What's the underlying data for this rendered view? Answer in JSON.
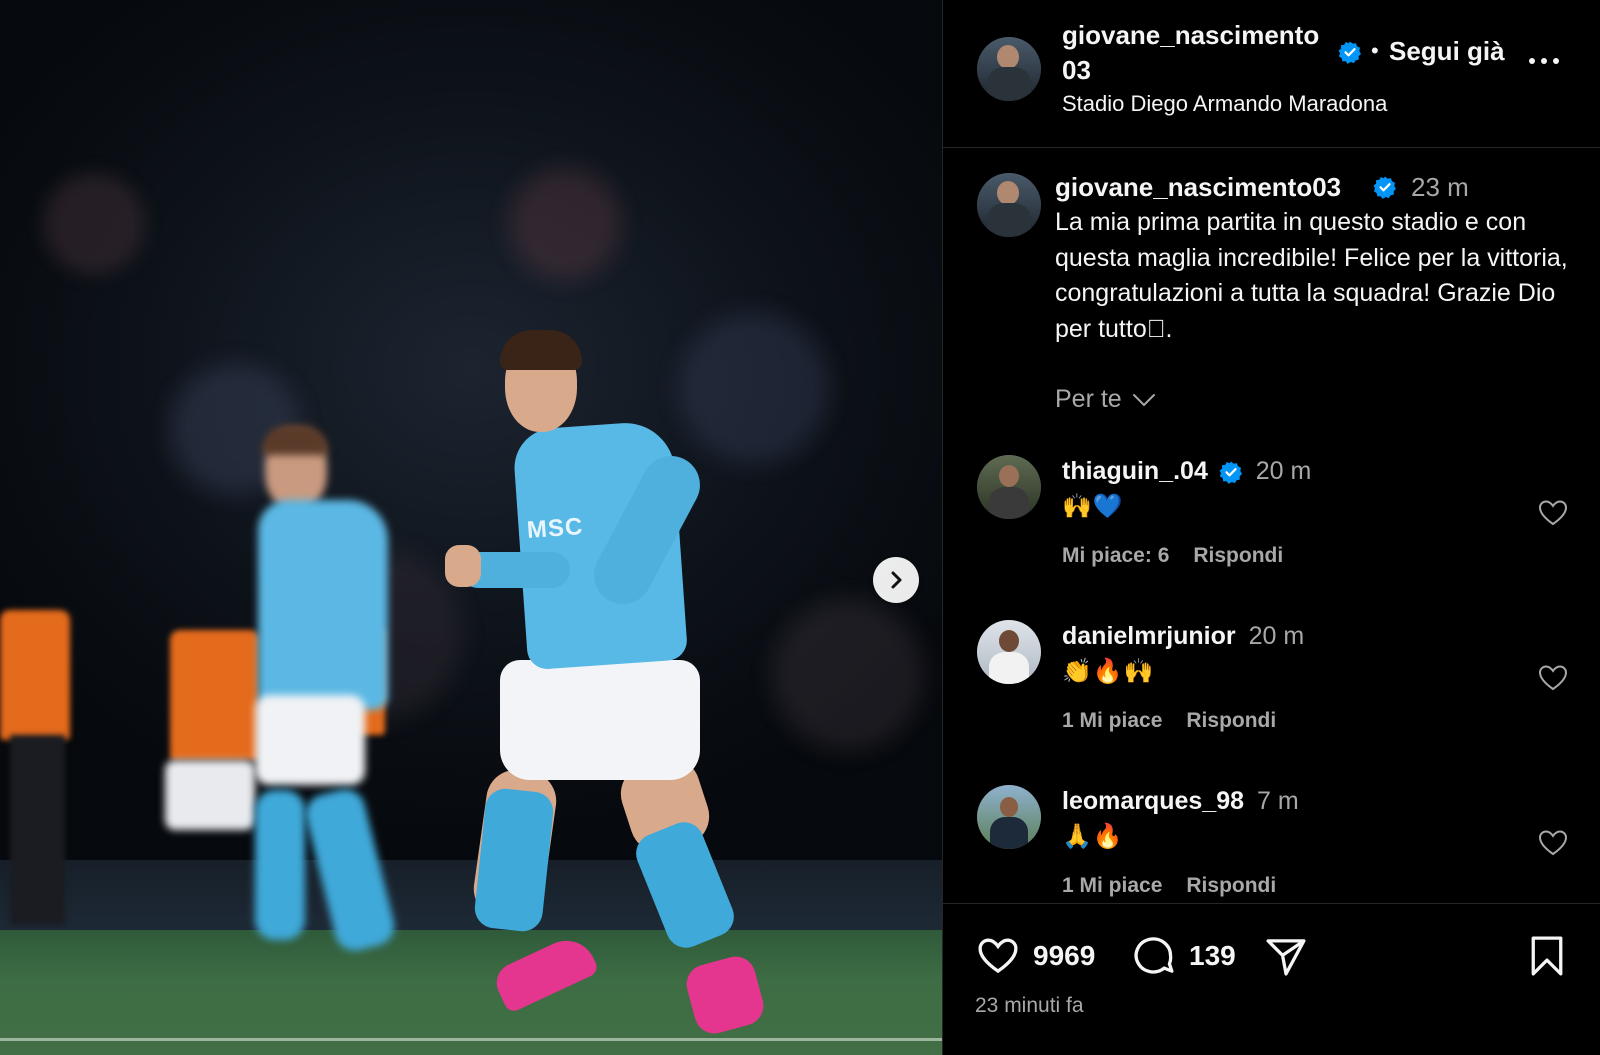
{
  "post": {
    "author": "giovane_nascimento03",
    "follow_label": "Segui già",
    "location": "Stadio Diego Armando Maradona",
    "caption_time": "23 m",
    "caption": "La mia prima partita in questo stadio e con questa maglia incredibile! Felice per la vittoria, congratulazioni a tutta la squadra! Grazie Dio per tutto🏼.",
    "photo_sponsor": "MSC",
    "sort_label": "Per te",
    "likes": "9969",
    "comments_count": "139",
    "time_ago": "23 minuti fa"
  },
  "comments": [
    {
      "user": "thiaguin_.04",
      "verified": true,
      "time": "20 m",
      "text": "🙌💙",
      "likes_label": "Mi piace: 6",
      "reply_label": "Rispondi"
    },
    {
      "user": "danielmrjunior",
      "verified": false,
      "time": "20 m",
      "text": "👏🔥🙌",
      "likes_label": "1 Mi piace",
      "reply_label": "Rispondi"
    },
    {
      "user": "leomarques_98",
      "verified": false,
      "time": "7 m",
      "text": "🙏🔥",
      "likes_label": "1 Mi piace",
      "reply_label": "Rispondi"
    }
  ],
  "icons": {
    "verified": "verified-badge-icon",
    "more": "more-options-icon",
    "next": "chevron-right-icon",
    "sort": "chevron-down-icon",
    "like": "heart-icon",
    "comment": "comment-icon",
    "share": "share-icon",
    "save": "bookmark-icon"
  },
  "colors": {
    "verified": "#0095f6",
    "background": "#000000",
    "secondary_text": "#a8a8a8"
  }
}
